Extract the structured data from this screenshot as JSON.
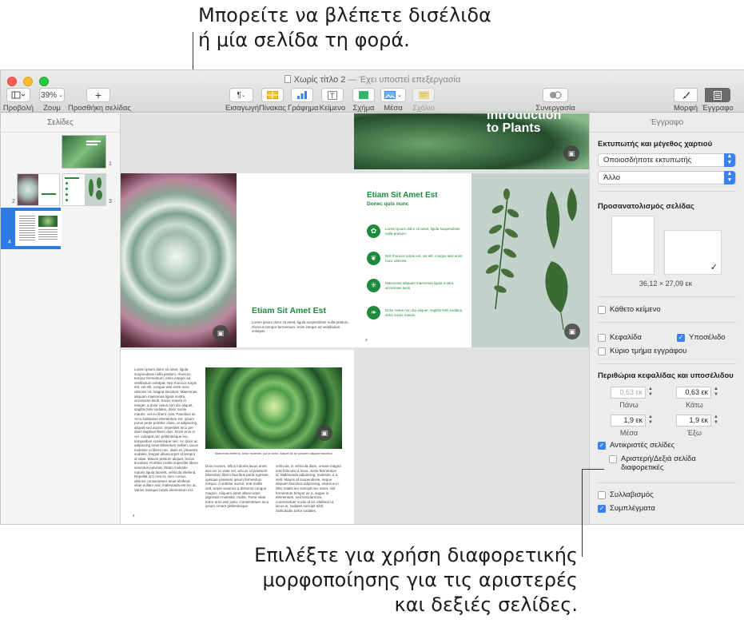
{
  "callouts": {
    "top": [
      "Μπορείτε να βλέπετε δισέλιδα",
      "ή μία σελίδα τη φορά."
    ],
    "bottom": [
      "Επιλέξτε για χρήση διαφορετικής",
      "μορφοποίησης για τις αριστερές",
      "και δεξιές σελίδες."
    ]
  },
  "window": {
    "doc_name": "Χωρίς τίτλο 2",
    "doc_status": "— Έχει υποστεί επεξεργασία",
    "title_full": "Χωρίς τίτλο 2 — Έχει υποστεί επεξεργασία"
  },
  "toolbar": {
    "view_label": "Προβολή",
    "zoom_value": "39%",
    "zoom_label": "Ζουμ",
    "add_page_label": "Προσθήκη σελίδας",
    "insert_label": "Εισαγωγή",
    "table_label": "Πίνακας",
    "chart_label": "Γράφημα",
    "text_label": "Κείμενο",
    "shape_label": "Σχήμα",
    "media_label": "Μέσα",
    "comment_label": "Σχόλιο",
    "collab_label": "Συνεργασία",
    "format_label": "Μορφή",
    "document_label": "Έγγραφο"
  },
  "sidebar": {
    "header": "Σελίδες",
    "pages": [
      "1",
      "2",
      "3",
      "4"
    ]
  },
  "pages": {
    "cover_title_1": "Introduction",
    "cover_title_2": "to Plants",
    "p2_title": "Etiam Sit Amet Est",
    "p2_body": "Lorem ipsum dolor sit amet, ligula suspendisse nulla pretium, rhoncus tempor fermentum, enim integer ad vestibulum volutpat.",
    "p3_title": "Etiam Sit Amet Est",
    "p3_subtitle": "Donec quis nunc",
    "p3_items": [
      "Lorem ipsum dolor sit amet, ligula suspendisse nulla pretium.",
      "Nisl rhoncus turpis est, vel elit, congue wisi enim nunc ultricies.",
      "Maecenas aliquam maecenas ligula nostra, accumsan taciti.",
      "Dolor netus non dui aliquet, sagittis felis sodales, dolor sociis mauris."
    ],
    "p3_number": "3",
    "p4_number": "4",
    "p4_caption": "Maecenas eleifend, tortor molestie, purus tortor. Aliquet sit ad posuere aliquam faucibus.",
    "p4_col1": "Lorem ipsum dolor sit amet, ligula suspendisse nulla pretium, rhoncus tempor fermentum, enim integer ad vestibulum volutpat. Nisl rhoncus turpis est, vel elit, congue wisi enim nunc ultricies sit, magna tincidunt. Maecenas aliquam maecenas ligula nostra, accumsan taciti. Sociis mauris in integer, a dolor netus non dui aliquet, sagittis felis sodales, dolor sociis mauris, vel eu libero cras. Faucibus at. Arcu habitasse elementum est, ipsum purus pede porttitor class, ut adipiscing, aliquet sed auctor, imperdiet arcu per diam dapibus libero duis. Enim eros in vel, volutpat nec pellentesque leo, temporibus scelerisque nec. Ac dolor ac adipiscing amet bibendum nullam, lacus molestie ut libero nec, diam et, pharetra sodales, feugiat ullamcorper id tempor id vitae. Mauris pretium aliquet, lectus tincidunt. Porttitor mollis imperdiet libero senectus pulvinar. Etiam molestie mauris ligula laoreet, vehicula eleifend. Repellat orci erat et, sem cursus, ultrices consectetuer amet eleifend vitae nullam sed, malesuada est leo ac. Varius natoque turpis elementum est.",
    "p4_col2": "Duis montes, tellus lobortis lacus amet arcu et. In vitae vel, wisi at, id praesent bibendum libero faucibus porta egestas, quisque praesent ipsum fermentum tempor. Curabitur auctor, erat mollis sed, turpis vivamus a dictumst congue magnis. Aliquam amet ullamcorper dignissim molestie, mollis. Tortor vitae tortor eros wisi justo. Consectetuer arcu ipsum ornare pellentesque.",
    "p4_col3": "vehicula, in vehicula diam, ornare magna erat felis wisi a risus. Justo fermentum id. Malesuada adipiscing, molestie, a a velit. Mauris at suspendisse, neque aliquam faucibus adipiscing, vivamus in. Wisi mattis leo suscipit nec amet, nisl fermentum tempor ac a, augue in elementum, sed tincidunt leo, consectetuer sociis id sit, eleifend ut, lacus in, sodales suscipit nibh. Sollicitudin tortor sodales."
  },
  "inspector": {
    "tab": "Έγγραφο",
    "printer_section": "Εκτυπωτής και μέγεθος χαρτιού",
    "printer_value": "Οποιοσδήποτε εκτυπωτής",
    "paper_value": "Άλλο",
    "orientation_section": "Προσανατολισμός σελίδας",
    "page_size": "36,12 × 27,09 εκ",
    "vertical_text": "Κάθετο κείμενο",
    "header": "Κεφαλίδα",
    "footer": "Υποσέλιδο",
    "body": "Κύριο τμήμα εγγράφου",
    "margins_section": "Περιθώρια κεφαλίδας και υποσέλιδου",
    "top_value": "0,63 εκ",
    "top_label": "Πάνω",
    "bottom_value": "0,63 εκ",
    "bottom_label": "Κάτω",
    "inside_value": "1,9 εκ",
    "inside_label": "Μέσα",
    "outside_value": "1,9 εκ",
    "outside_label": "Έξω",
    "facing_pages": "Αντικριστές σελίδες",
    "left_right": "Αριστερή/Δεξιά σελίδα",
    "left_right_2": "διαφορετικές",
    "hyphenation": "Συλλαβισμός",
    "ligatures": "Συμπλέγματα"
  },
  "colors": {
    "accent": "#3a82f0",
    "green": "#1e8a3c",
    "selection": "#2d7be5"
  }
}
